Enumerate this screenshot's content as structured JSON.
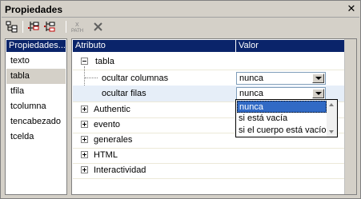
{
  "window": {
    "title": "Propiedades",
    "close_glyph": "✕"
  },
  "toolbar": {
    "buttons": [
      {
        "name": "tree-layout-icon"
      },
      {
        "name": "insert-child-icon"
      },
      {
        "name": "insert-sibling-icon"
      },
      {
        "name": "xpath-icon",
        "label": "PATH"
      },
      {
        "name": "delete-icon"
      }
    ]
  },
  "left_panel": {
    "header": "Propiedades...",
    "items": [
      "texto",
      "tabla",
      "tfila",
      "tcolumna",
      "tencabezado",
      "tcelda"
    ],
    "selected_index": 1
  },
  "grid": {
    "col_attribute": "Atributo",
    "col_value": "Valor",
    "rows": [
      {
        "label": "tabla",
        "expander": "minus"
      },
      {
        "label": "ocultar columnas",
        "value": "nunca"
      },
      {
        "label": "ocultar filas",
        "value": "nunca"
      },
      {
        "label": "Authentic",
        "expander": "plus"
      },
      {
        "label": "evento",
        "expander": "plus"
      },
      {
        "label": "generales",
        "expander": "plus"
      },
      {
        "label": "HTML",
        "expander": "plus"
      },
      {
        "label": "Interactividad",
        "expander": "plus"
      }
    ]
  },
  "dropdown": {
    "options": [
      "nunca",
      "si está vacía",
      "si el cuerpo está vacío"
    ],
    "selected_index": 0
  },
  "colors": {
    "header_bg": "#0a246a",
    "selection_bg": "#316ac5",
    "panel_bg": "#d4d0c8"
  }
}
